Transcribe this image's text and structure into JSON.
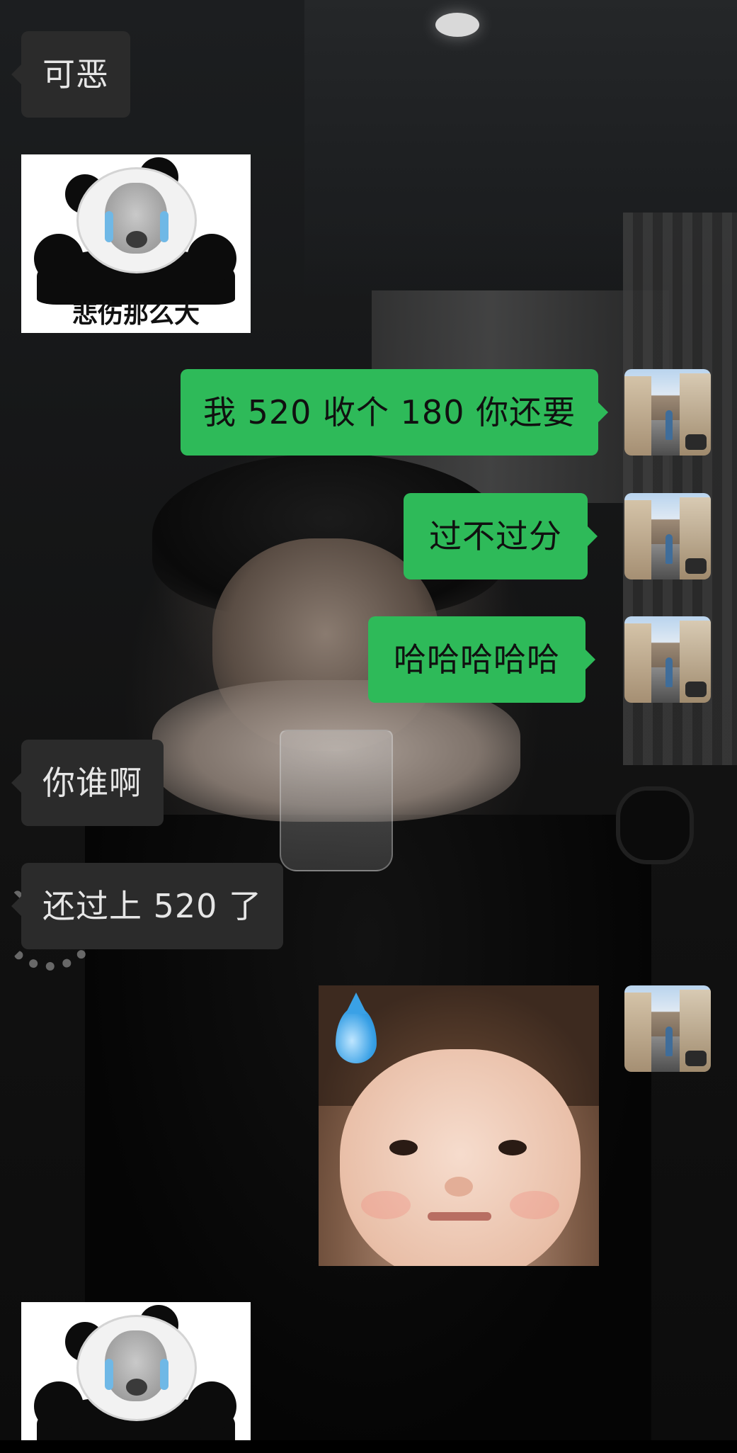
{
  "chat": {
    "messages": [
      {
        "id": 0,
        "side": "in",
        "type": "text",
        "text": "可恶"
      },
      {
        "id": 1,
        "side": "in",
        "type": "sticker",
        "sticker": "crying-panda",
        "caption": "悲伤那么大"
      },
      {
        "id": 2,
        "side": "out",
        "type": "text",
        "text": "我 520 收个 180 你还要"
      },
      {
        "id": 3,
        "side": "out",
        "type": "text",
        "text": "过不过分"
      },
      {
        "id": 4,
        "side": "out",
        "type": "text",
        "text": "哈哈哈哈哈"
      },
      {
        "id": 5,
        "side": "in",
        "type": "text",
        "text": "你谁啊"
      },
      {
        "id": 6,
        "side": "in",
        "type": "text",
        "text": "还过上 520 了"
      },
      {
        "id": 7,
        "side": "out",
        "type": "sticker",
        "sticker": "sweating-child-face"
      },
      {
        "id": 8,
        "side": "in",
        "type": "sticker",
        "sticker": "crying-panda",
        "caption": ""
      }
    ]
  },
  "theme": {
    "incoming_bubble": "#2b2b2b",
    "outgoing_bubble": "#2eba59",
    "incoming_text": "#e6e6e6",
    "outgoing_text": "#101010"
  },
  "icons": {
    "self_avatar": "street-photo-avatar",
    "sweat": "sweat-drop-icon"
  }
}
